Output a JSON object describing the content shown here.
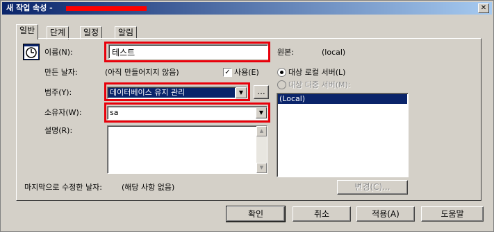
{
  "window": {
    "title": "새 작업 속성 -",
    "close_glyph": "✕"
  },
  "tabs": [
    "일반",
    "단계",
    "일정",
    "알림"
  ],
  "general": {
    "name_label": "이름(N):",
    "name_value": "테스트",
    "source_label": "원본:",
    "source_value": "(local)",
    "created_label": "만든 날자:",
    "created_value": "(아직 만들어지지 않음)",
    "enabled_label": "사용(E)",
    "enabled_checked": true,
    "category_label": "범주(Y):",
    "category_value": "데이터베이스 유지 관리",
    "browse_label": "...",
    "owner_label": "소유자(W):",
    "owner_value": "sa",
    "description_label": "설명(R):",
    "description_value": "",
    "target_local_label": "대상 로컬 서버(L)",
    "target_multi_label": "대상 다중 서버(M):",
    "target_list": [
      "(Local)"
    ],
    "last_modified_label": "마지막으로 수정한 날자:",
    "last_modified_value": "(해당 사항 없음)",
    "change_label": "변경(C)..."
  },
  "footer": {
    "ok": "확인",
    "cancel": "취소",
    "apply": "적용(A)",
    "help": "도움말"
  }
}
